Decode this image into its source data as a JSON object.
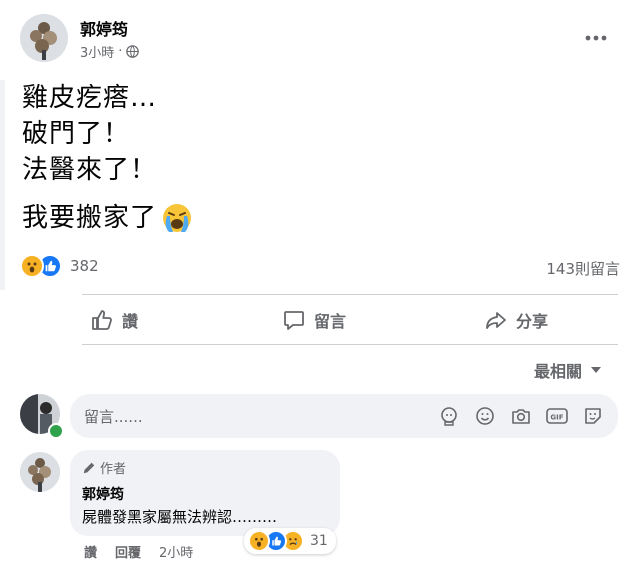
{
  "post": {
    "author": "郭婷筠",
    "time": "3小時",
    "lines": [
      "雞皮疙瘩…",
      "破門了！",
      "法醫來了！",
      "我要搬家了"
    ],
    "reaction_count": "382",
    "comment_count": "143則留言"
  },
  "actions": {
    "like": "讚",
    "comment": "留言",
    "share": "分享"
  },
  "sort": {
    "label": "最相關"
  },
  "composer": {
    "placeholder": "留言......"
  },
  "comment": {
    "badge": "作者",
    "author": "郭婷筠",
    "text": "屍體發黑家屬無法辨認………",
    "reaction_count": "31",
    "like": "讚",
    "reply": "回覆",
    "time": "2小時"
  },
  "colors": {
    "like_blue": "#1877f2",
    "wow_yellow": "#f7b125",
    "online_green": "#31a24c"
  }
}
